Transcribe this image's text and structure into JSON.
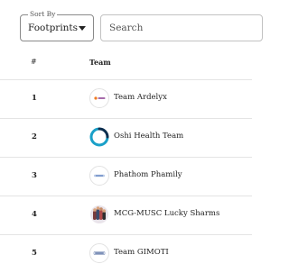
{
  "sort": {
    "label": "Sort By",
    "value": "Footprints"
  },
  "search": {
    "placeholder": "Search"
  },
  "table": {
    "headers": {
      "rank": "#",
      "team": "Team"
    },
    "rows": [
      {
        "rank": "1",
        "name": "Team Ardelyx",
        "logo_icon": "ardelyx-logo-icon"
      },
      {
        "rank": "2",
        "name": "Oshi Health Team",
        "logo_icon": "oshi-health-logo-icon"
      },
      {
        "rank": "3",
        "name": "Phathom Phamily",
        "logo_icon": "phathom-logo-icon"
      },
      {
        "rank": "4",
        "name": "MCG-MUSC Lucky Sharms",
        "logo_icon": "lucky-sharms-logo-icon"
      },
      {
        "rank": "5",
        "name": "Team GIMOTI",
        "logo_icon": "gimoti-logo-icon"
      }
    ]
  }
}
